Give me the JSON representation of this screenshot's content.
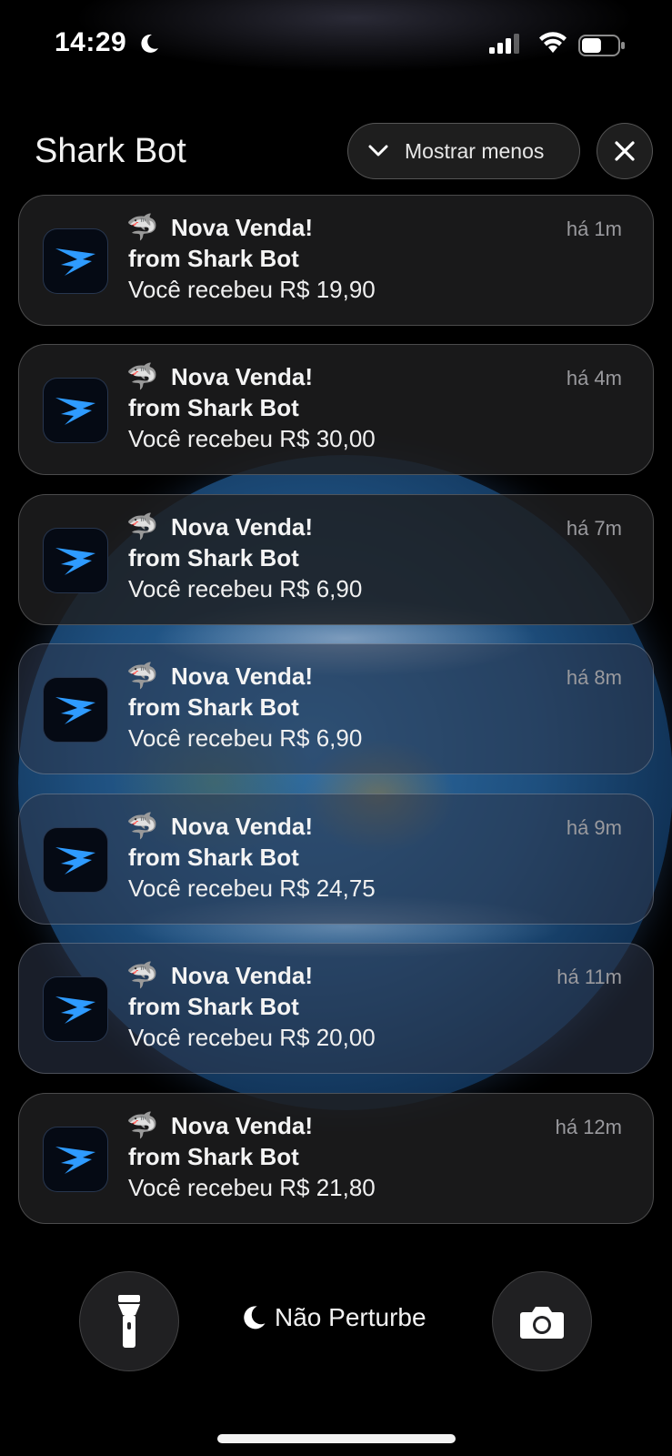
{
  "status_bar": {
    "time": "14:29",
    "battery_level": 0.55
  },
  "group": {
    "title": "Shark Bot",
    "show_less_label": "Mostrar menos"
  },
  "notifications": [
    {
      "emoji": "🦈",
      "title": "Nova Venda!",
      "subtitle": "from Shark Bot",
      "body": "Você recebeu R$ 19,90",
      "time": "há 1m"
    },
    {
      "emoji": "🦈",
      "title": "Nova Venda!",
      "subtitle": "from Shark Bot",
      "body": "Você recebeu R$ 30,00",
      "time": "há 4m"
    },
    {
      "emoji": "🦈",
      "title": "Nova Venda!",
      "subtitle": "from Shark Bot",
      "body": "Você recebeu R$ 6,90",
      "time": "há 7m"
    },
    {
      "emoji": "🦈",
      "title": "Nova Venda!",
      "subtitle": "from Shark Bot",
      "body": "Você recebeu R$ 6,90",
      "time": "há 8m"
    },
    {
      "emoji": "🦈",
      "title": "Nova Venda!",
      "subtitle": "from Shark Bot",
      "body": "Você recebeu R$ 24,75",
      "time": "há 9m"
    },
    {
      "emoji": "🦈",
      "title": "Nova Venda!",
      "subtitle": "from Shark Bot",
      "body": "Você recebeu R$ 20,00",
      "time": "há 11m"
    },
    {
      "emoji": "🦈",
      "title": "Nova Venda!",
      "subtitle": "from Shark Bot",
      "body": "Você recebeu R$ 21,80",
      "time": "há 12m"
    }
  ],
  "bottom": {
    "dnd_label": "Não Perturbe"
  },
  "colors": {
    "app_icon_accent": "#2e9bff",
    "background": "#000000"
  },
  "icons": [
    "moon-icon",
    "cellular-signal-icon",
    "wifi-icon",
    "battery-icon",
    "chevron-down-icon",
    "close-icon",
    "shark-bot-app-icon",
    "flashlight-icon",
    "camera-icon"
  ]
}
